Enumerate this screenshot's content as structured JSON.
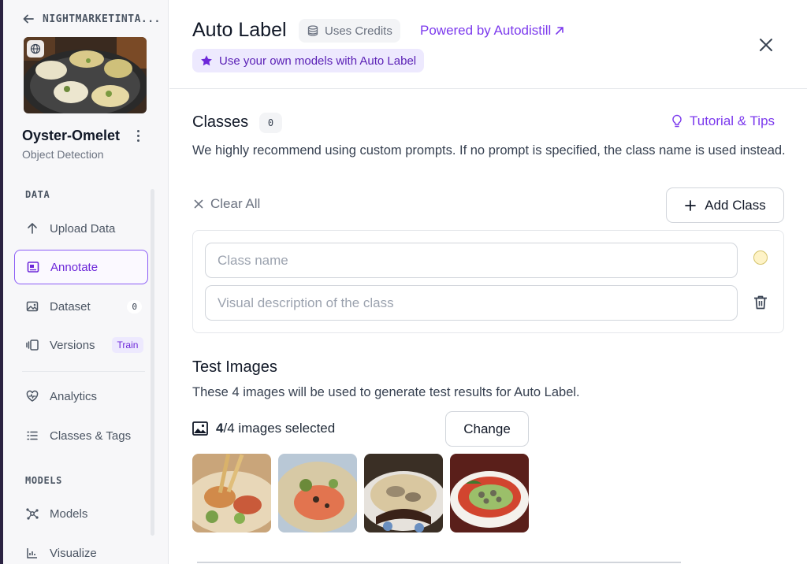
{
  "sidebar": {
    "project_name": "NIGHTMARKETINTA...",
    "project_title": "Oyster-Omelet",
    "project_type": "Object Detection",
    "sections": {
      "data": "DATA",
      "models": "MODELS"
    },
    "items": [
      {
        "label": "Upload Data",
        "icon": "upload-arrow-icon"
      },
      {
        "label": "Annotate",
        "icon": "annotate-icon",
        "active": true
      },
      {
        "label": "Dataset",
        "icon": "images-icon",
        "count": "0"
      },
      {
        "label": "Versions",
        "icon": "versions-icon",
        "badge": "Train"
      },
      {
        "label": "Analytics",
        "icon": "heart-pulse-icon"
      },
      {
        "label": "Classes & Tags",
        "icon": "list-icon"
      },
      {
        "label": "Models",
        "icon": "nodes-icon"
      },
      {
        "label": "Visualize",
        "icon": "chart-icon"
      }
    ]
  },
  "header": {
    "title": "Auto Label",
    "credits_label": "Uses Credits",
    "powered_label": "Powered by Autodistill",
    "own_models_label": "Use your own models with Auto Label"
  },
  "classes": {
    "title": "Classes",
    "count": "0",
    "tips_label": "Tutorial & Tips",
    "description": "We highly recommend using custom prompts. If no prompt is specified, the class name is used instead.",
    "clear_all_label": "Clear All",
    "add_class_label": "Add Class",
    "class_name_placeholder": "Class name",
    "class_description_placeholder": "Visual description of the class",
    "class_name_value": "",
    "class_description_value": ""
  },
  "test_images": {
    "title": "Test Images",
    "description": "These 4 images will be used to generate test results for Auto Label.",
    "selected_count": "4",
    "selected_rest": "/4 images selected",
    "change_label": "Change"
  },
  "colors": {
    "accent": "#7c3aed",
    "accent_light": "#ede9fe",
    "class_color": "#fef3c7"
  }
}
